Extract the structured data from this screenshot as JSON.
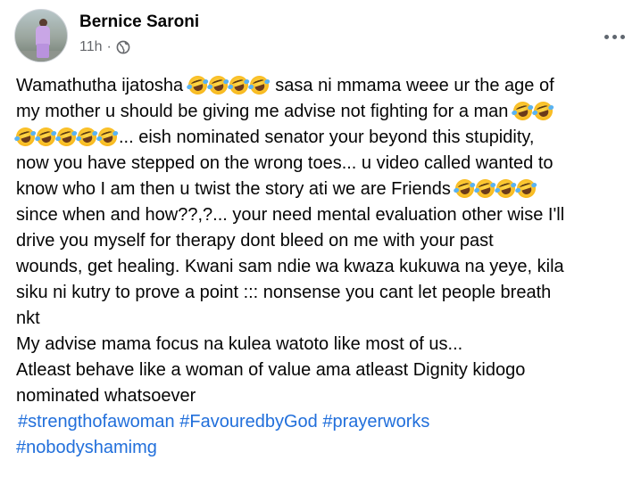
{
  "post": {
    "author": "Bernice Saroni",
    "time": "11h",
    "separator": "·",
    "privacy_icon": "globe-icon",
    "more_icon": "more-options-icon",
    "emoji_icon": "rolling-on-floor-laughing-emoji",
    "lines": {
      "l1a": "Wamathutha ijatosha",
      "l1b": "sasa ni mmama weee ur the age of",
      "l2a": "my mother u should be giving me advise not fighting for a man",
      "l3a": "... eish nominated senator your beyond this stupidity,",
      "l4": "now you have stepped on the wrong toes... u video called wanted to",
      "l5a": "know who I am then u twist the story ati we are Friends",
      "l6": "since when and how??,?... your need mental evaluation other wise I'll",
      "l7": "drive you myself  for therapy dont bleed on me with your past",
      "l8": "wounds, get healing.  Kwani sam ndie wa kwaza kukuwa na yeye, kila",
      "l9": "siku ni kutry to prove a point ::: nonsense you cant let people breath",
      "l10": "nkt",
      "l11": "My advise mama focus na kulea watoto like most of us...",
      "l12": "Atleast behave like a woman of value ama atleast Dignity kidogo",
      "l13": "nominated whatsoever"
    },
    "hashtags": [
      "#strengthofawoman",
      "#FavouredbyGod",
      "#prayerworks",
      "#nobodyshamimg"
    ]
  },
  "colors": {
    "text": "#050505",
    "secondary": "#65676b",
    "link": "#216fdb"
  }
}
